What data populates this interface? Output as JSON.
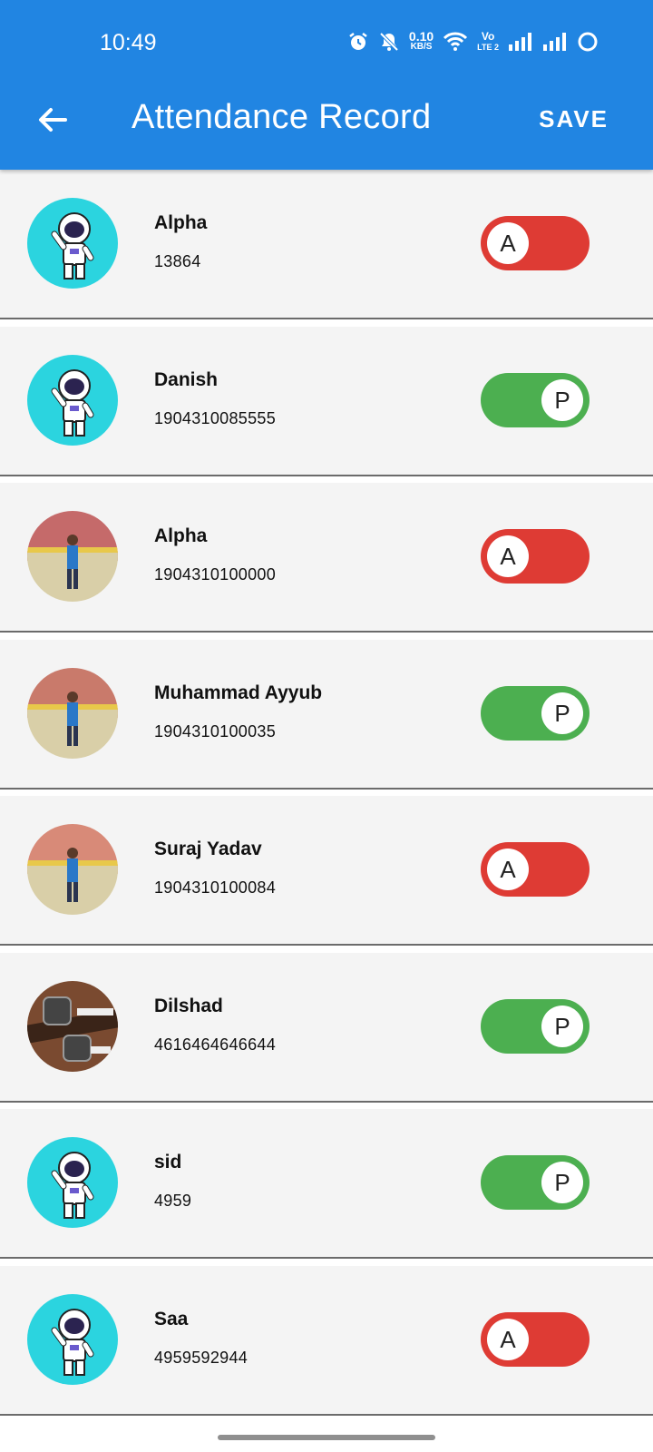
{
  "status_bar": {
    "time": "10:49",
    "net_speed_value": "0.10",
    "net_speed_unit": "KB/S",
    "volte": "Vo",
    "volte_sub": "LTE 2"
  },
  "app_bar": {
    "title": "Attendance Record",
    "save_label": "SAVE"
  },
  "students": [
    {
      "name": "Alpha",
      "id": "13864",
      "status": "A",
      "avatar": "astronaut"
    },
    {
      "name": "Danish",
      "id": "1904310085555",
      "status": "P",
      "avatar": "astronaut"
    },
    {
      "name": "Alpha",
      "id": "1904310100000",
      "status": "A",
      "avatar": "photo"
    },
    {
      "name": "Muhammad Ayyub",
      "id": "1904310100035",
      "status": "P",
      "avatar": "photo"
    },
    {
      "name": "Suraj Yadav",
      "id": "1904310100084",
      "status": "A",
      "avatar": "photo"
    },
    {
      "name": "Dilshad",
      "id": "4616464646644",
      "status": "P",
      "avatar": "photo-watches"
    },
    {
      "name": "sid",
      "id": "4959",
      "status": "P",
      "avatar": "astronaut"
    },
    {
      "name": "Saa",
      "id": "4959592944",
      "status": "A",
      "avatar": "astronaut"
    }
  ],
  "colors": {
    "app_bar": "#2185e2",
    "absent": "#de3b34",
    "present": "#4caf50",
    "row_bg": "#f4f4f4",
    "avatar_bg": "#2bd4df"
  }
}
